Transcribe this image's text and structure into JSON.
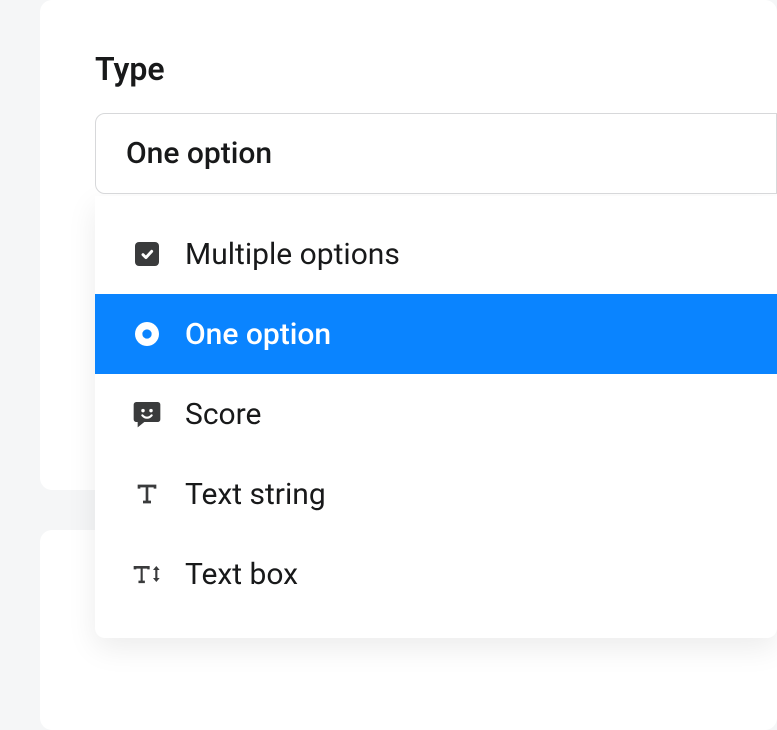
{
  "field": {
    "label": "Type",
    "selected": "One option"
  },
  "options": {
    "multiple": "Multiple options",
    "one": "One option",
    "score": "Score",
    "textString": "Text string",
    "textBox": "Text box"
  }
}
